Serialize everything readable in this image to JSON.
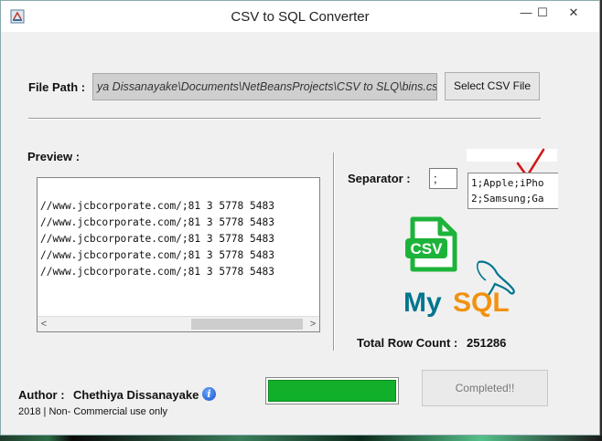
{
  "window": {
    "title": "CSV to SQL Converter",
    "controls": {
      "minimize": "—",
      "maximize": "☐",
      "close": "✕"
    }
  },
  "file_path": {
    "label": "File Path :",
    "value": "ya Dissanayake\\Documents\\NetBeansProjects\\CSV to SLQ\\bins.csv",
    "select_button": "Select CSV File"
  },
  "preview": {
    "label": "Preview :",
    "lines": [
      "//www.jcbcorporate.com/;81 3 5778 5483",
      "//www.jcbcorporate.com/;81 3 5778 5483",
      "//www.jcbcorporate.com/;81 3 5778 5483",
      "//www.jcbcorporate.com/;81 3 5778 5483",
      "//www.jcbcorporate.com/;81 3 5778 5483"
    ],
    "scroll_left": "<",
    "scroll_right": ">"
  },
  "separator": {
    "label": "Separator :",
    "value": ";",
    "sample_lines": [
      "1;Apple;iPho",
      "2;Samsung;Ga"
    ]
  },
  "logos": {
    "csv": "CSV",
    "mysql_my": "My",
    "mysql_sql": "SQL"
  },
  "row_count": {
    "label": "Total Row Count :",
    "value": "251286"
  },
  "author": {
    "label": "Author :",
    "name": "Chethiya Dissanayake",
    "info_glyph": "i",
    "footer": "2018 | Non- Commercial use only"
  },
  "progress": {
    "fraction": 1.0
  },
  "status": {
    "completed_label": "Completed!!"
  },
  "colors": {
    "progress_fill": "#12b02a",
    "csv_green": "#1db33a",
    "mysql_blue": "#00758f",
    "mysql_orange": "#f29111",
    "checkmark_red": "#d01818"
  }
}
